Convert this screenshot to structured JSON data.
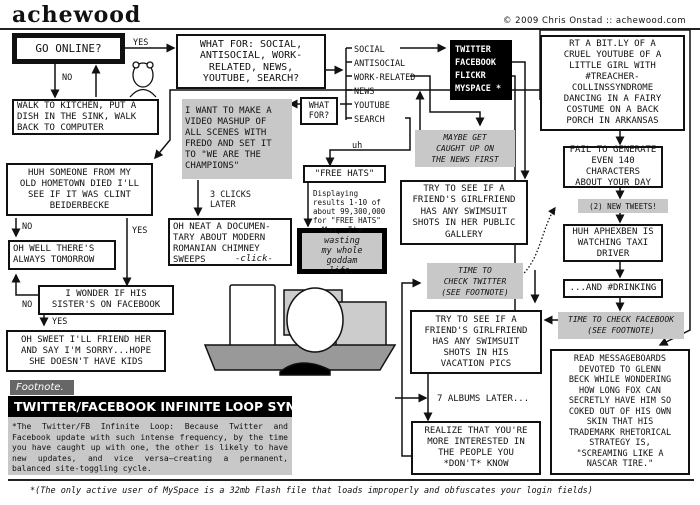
{
  "header": {
    "logo": "achewood",
    "copyright": "© 2009 Chris Onstad :: achewood.com"
  },
  "flow": {
    "go_online": "GO ONLINE?",
    "yes1": "YES",
    "no1": "NO",
    "what_for": "WHAT FOR: SOCIAL,\nANTISOCIAL, WORK-\nRELATED, NEWS,\nYOUTUBE, SEARCH?",
    "options": [
      "SOCIAL",
      "ANTISOCIAL",
      "WORK-RELATED",
      "NEWS",
      "YOUTUBE",
      "SEARCH"
    ],
    "sites": [
      "TWITTER",
      "FACEBOOK",
      "FLICKR",
      "MYSPACE *"
    ],
    "kitchen": "WALK TO KITCHEN, PUT A\nDISH IN THE SINK, WALK\nBACK TO COMPUTER",
    "mashup": "I WANT TO MAKE A\nVIDEO MASHUP OF\nALL SCENES WITH\nFREDO AND SET IT\nTO \"WE ARE THE\nCHAMPIONS\"",
    "what_for_short": "WHAT\nFOR?",
    "three_clicks": "3 CLICKS\nLATER",
    "documentary": "OH NEAT A DOCUMEN-\nTARY ABOUT MODERN\nROMANIAN CHIMNEY\nSWEEPS",
    "click": "-click-",
    "hometown": "HUH SOMEONE FROM MY\nOLD HOMETOWN DIED I'LL\nSEE IF IT WAS CLINT\nBEIDERBECKE",
    "no2": "NO",
    "yes2": "YES",
    "tomorrow": "OH WELL THERE'S\nALWAYS TOMORROW",
    "sister": "I WONDER IF HIS\nSISTER'S ON FACEBOOK",
    "no3": "NO",
    "yes3": "YES",
    "friend_her": "OH SWEET I'LL FRIEND HER\nAND SAY I'M SORRY...HOPE\nSHE DOESN'T HAVE KIDS",
    "uh": "uh",
    "free_hats": "\"FREE HATS\"",
    "search_results": "Displaying\nresults 1-10 of\nabout 99,300,000\nfor \"FREE HATS\"",
    "wasting": "Man, I'm wasting\nmy whole goddam\nlife.",
    "maybe_news": "MAYBE GET\nCAUGHT UP ON\nTHE NEWS FIRST",
    "swimsuit_public": "TRY TO SEE IF A\nFRIEND'S GIRLFRIEND\nHAS ANY SWIMSUIT\nSHOTS IN HER PUBLIC\nGALLERY",
    "time_twitter": "TIME TO\nCHECK TWITTER\n(SEE FOOTNOTE)",
    "swimsuit_vacation": "TRY TO SEE IF A\nFRIEND'S GIRLFRIEND\nHAS ANY SWIMSUIT\nSHOTS IN HIS\nVACATION PICS",
    "seven_albums": "7 ALBUMS LATER...",
    "realize": "REALIZE THAT YOU'RE\nMORE INTERESTED IN\nTHE PEOPLE YOU\n*DON'T* KNOW",
    "rt_bitly": "RT A BIT.LY OF A\nCRUEL YOUTUBE OF A\nLITTLE GIRL WITH\n#TREACHER-\nCOLLINSSYNDROME\nDANCING IN A FAIRY\nCOSTUME ON A BACK\nPORCH IN ARKANSAS",
    "fail_140": "FAIL TO GENERATE\nEVEN 140 CHARACTERS\nABOUT YOUR DAY",
    "new_tweets": "(2) NEW TWEETS!",
    "aphexben": "HUH APHEXBEN IS\nWATCHING TAXI\nDRIVER",
    "drinking": "...AND #DRINKING",
    "time_facebook": "TIME TO CHECK FACEBOOK\n(SEE FOOTNOTE)",
    "glenn_beck": "READ MESSAGEBOARDS\nDEVOTED TO GLENN\nBECK WHILE WONDERING\nHOW LONG FOX CAN\nSECRETLY HAVE HIM SO\nCOKED OUT OF HIS OWN\nSKIN THAT HIS\nTRADEMARK RHETORICAL\nSTRATEGY IS,\n\"SCREAMING LIKE A\nNASCAR TIRE.\""
  },
  "footnote": {
    "tab": "Footnote.",
    "title": "TWITTER/FACEBOOK INFINITE LOOP SYNDROME:",
    "body": "*The Twitter/FB Infinite Loop: Because Twitter and Facebook update with such intense frequency, by the time you have caught up with one, the other is likely to have new updates, and vice versa—creating a permanent, balanced site-toggling cycle."
  },
  "bottom_note": "*(The only active user of MySpace is a 32mb Flash file that loads improperly and obfuscates your login fields)"
}
